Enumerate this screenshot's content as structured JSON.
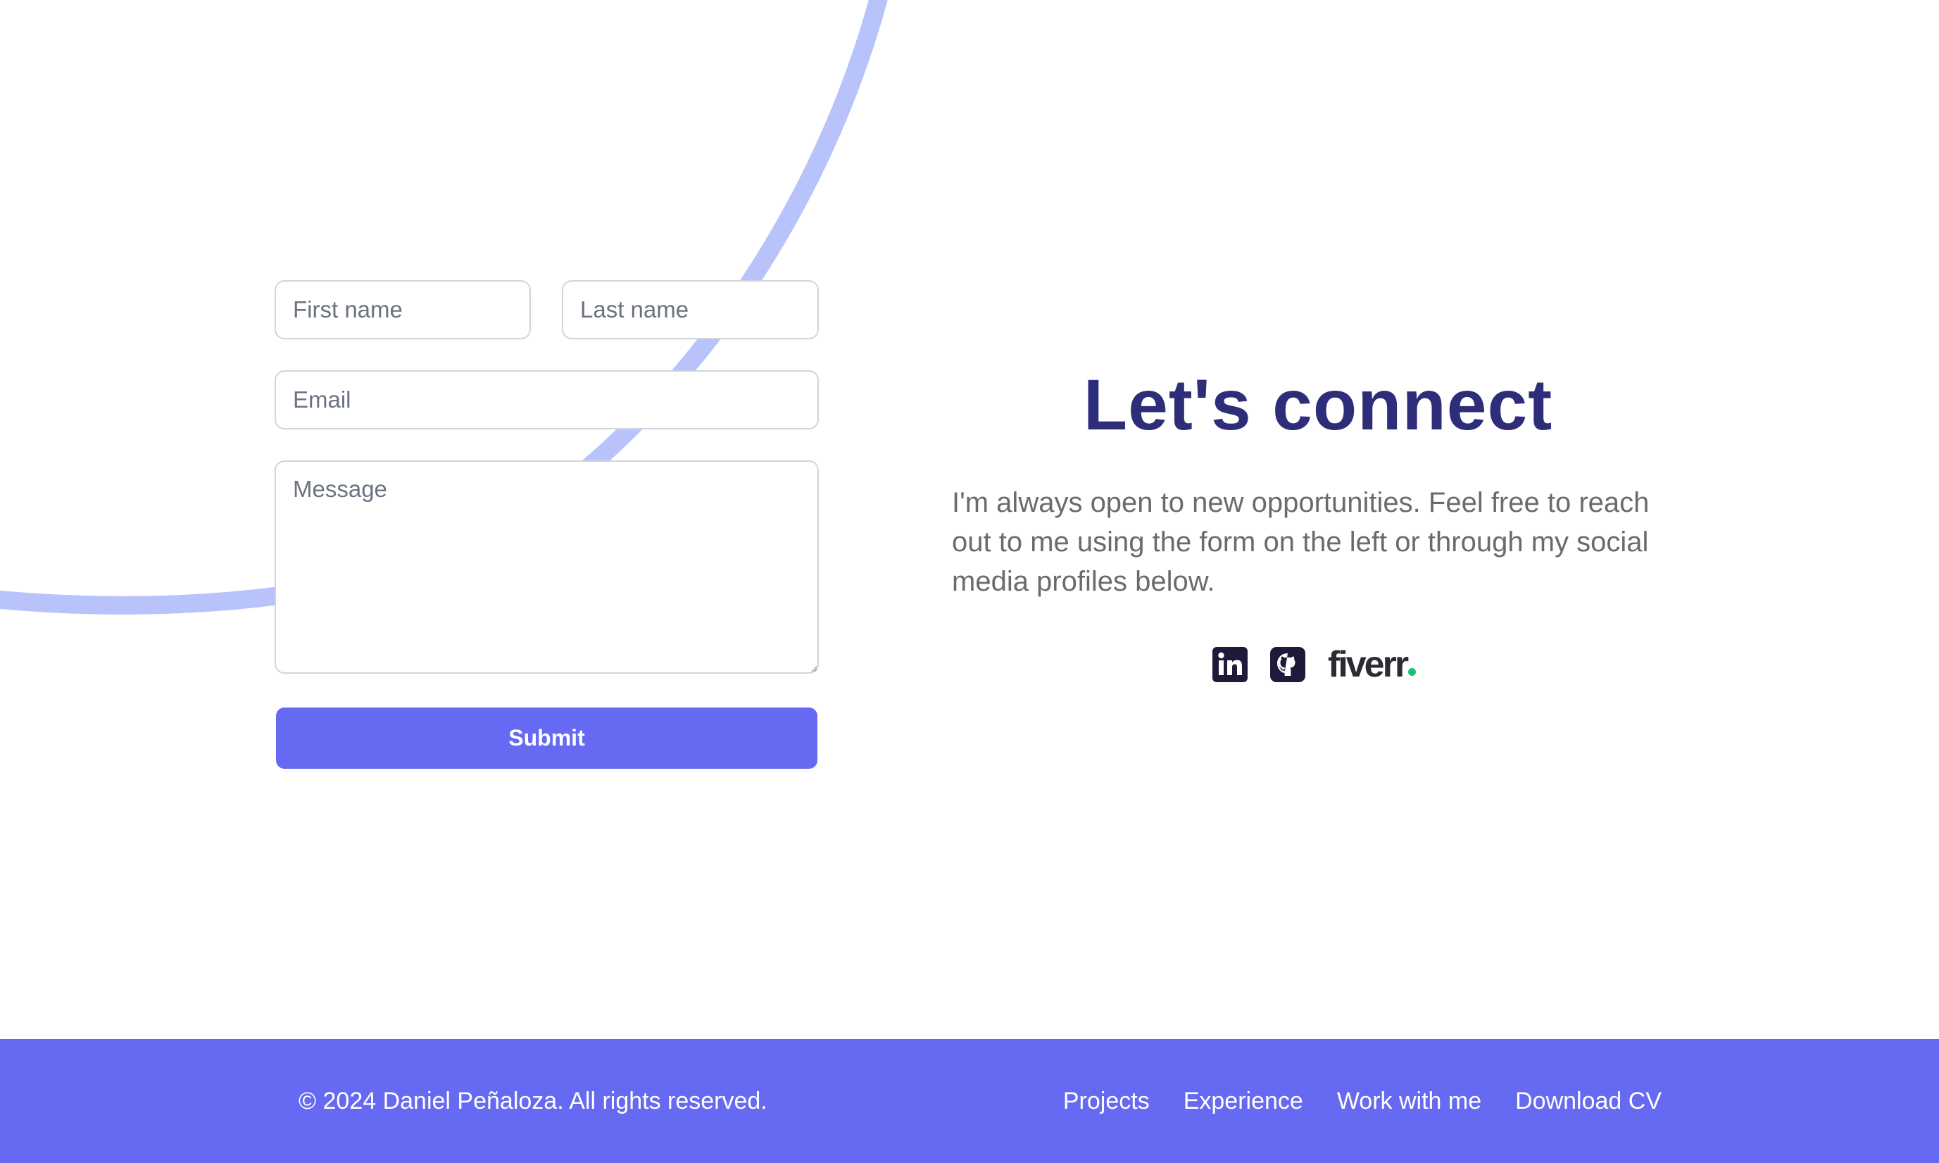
{
  "form": {
    "first_name_placeholder": "First name",
    "last_name_placeholder": "Last name",
    "email_placeholder": "Email",
    "message_placeholder": "Message",
    "submit_label": "Submit"
  },
  "connect": {
    "title": "Let's connect",
    "description": "I'm always open to new opportunities. Feel free to reach out to me using the form on the left or through my social media profiles below."
  },
  "social": {
    "items": [
      {
        "icon": "linkedin-icon"
      },
      {
        "icon": "github-icon"
      },
      {
        "icon": "fiverr-logo",
        "label": "fiverr"
      }
    ]
  },
  "footer": {
    "copyright": "© 2024 Daniel Peñaloza. All rights reserved.",
    "nav": [
      "Projects",
      "Experience",
      "Work with me",
      "Download CV"
    ]
  },
  "colors": {
    "accent": "#6669f1",
    "title": "#2e2d7a",
    "decorative_curve": "#b8c2fb",
    "fiverr_green": "#1dbf73"
  }
}
